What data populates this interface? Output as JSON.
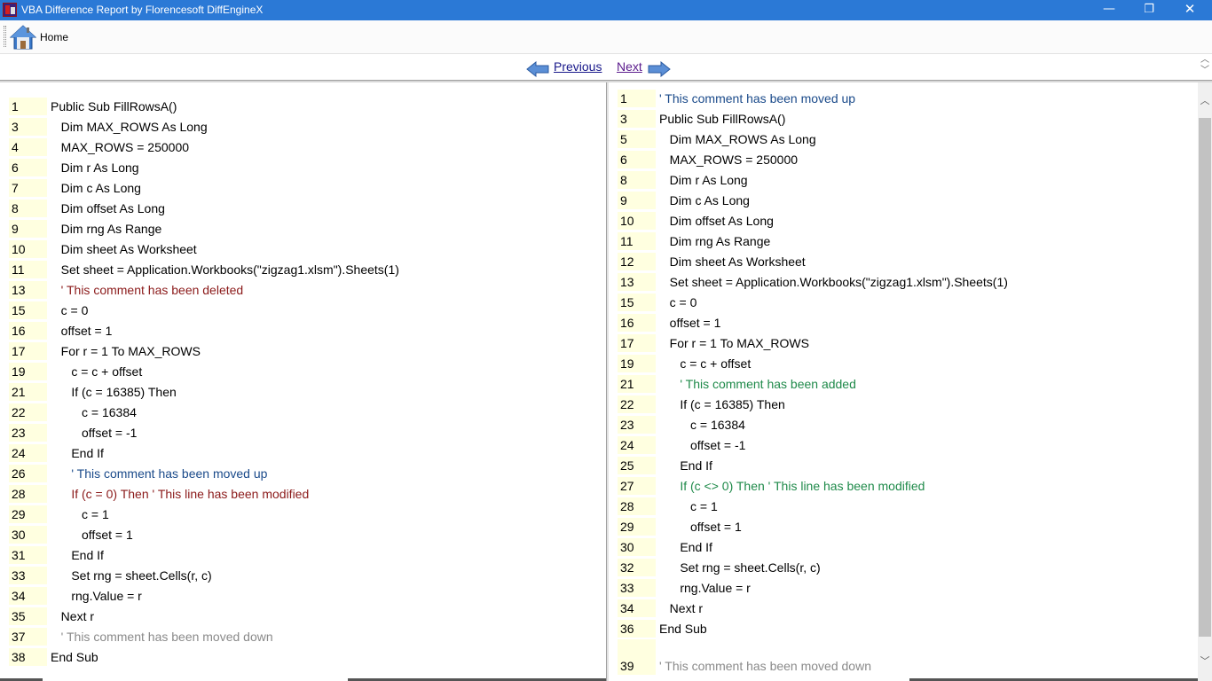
{
  "window": {
    "title": "VBA Difference Report by Florencesoft DiffEngineX",
    "minimize": "—",
    "maximize": "❐",
    "close": "✕"
  },
  "ribbon": {
    "home_label": "Home"
  },
  "nav": {
    "previous_label": "Previous",
    "next_label": "Next"
  },
  "colors": {
    "titlebar": "#2b79d6",
    "line_number_bg": "#ffffe0",
    "deleted": "#8b1a1a",
    "moved": "#1a4a8a",
    "added": "#1f8a4a",
    "moved_down": "#8a8a8a",
    "link": "#17178a"
  },
  "left_pane": {
    "lines": [
      {
        "num": "1",
        "text": "Public Sub FillRowsA()",
        "kind": "normal"
      },
      {
        "num": "3",
        "text": "   Dim MAX_ROWS As Long",
        "kind": "normal"
      },
      {
        "num": "4",
        "text": "   MAX_ROWS = 250000",
        "kind": "normal"
      },
      {
        "num": "6",
        "text": "   Dim r As Long",
        "kind": "normal"
      },
      {
        "num": "7",
        "text": "   Dim c As Long",
        "kind": "normal"
      },
      {
        "num": "8",
        "text": "   Dim offset As Long",
        "kind": "normal"
      },
      {
        "num": "9",
        "text": "   Dim rng As Range",
        "kind": "normal"
      },
      {
        "num": "10",
        "text": "   Dim sheet As Worksheet",
        "kind": "normal"
      },
      {
        "num": "11",
        "text": "   Set sheet = Application.Workbooks(\"zigzag1.xlsm\").Sheets(1)",
        "kind": "normal"
      },
      {
        "num": "13",
        "text": "   ' This comment has been deleted",
        "kind": "deleted"
      },
      {
        "num": "15",
        "text": "   c = 0",
        "kind": "normal"
      },
      {
        "num": "16",
        "text": "   offset = 1",
        "kind": "normal"
      },
      {
        "num": "17",
        "text": "   For r = 1 To MAX_ROWS",
        "kind": "normal"
      },
      {
        "num": "19",
        "text": "      c = c + offset",
        "kind": "normal"
      },
      {
        "num": "21",
        "text": "      If (c = 16385) Then",
        "kind": "normal"
      },
      {
        "num": "22",
        "text": "         c = 16384",
        "kind": "normal"
      },
      {
        "num": "23",
        "text": "         offset = -1",
        "kind": "normal"
      },
      {
        "num": "24",
        "text": "      End If",
        "kind": "normal"
      },
      {
        "num": "26",
        "text": "      ' This comment has been moved up",
        "kind": "moved"
      },
      {
        "num": "28",
        "text": "      If (c = 0) Then ' This line has been modified",
        "kind": "deleted"
      },
      {
        "num": "29",
        "text": "         c = 1",
        "kind": "normal"
      },
      {
        "num": "30",
        "text": "         offset = 1",
        "kind": "normal"
      },
      {
        "num": "31",
        "text": "      End If",
        "kind": "normal"
      },
      {
        "num": "33",
        "text": "      Set rng = sheet.Cells(r, c)",
        "kind": "normal"
      },
      {
        "num": "34",
        "text": "      rng.Value = r",
        "kind": "normal"
      },
      {
        "num": "35",
        "text": "   Next r",
        "kind": "normal"
      },
      {
        "num": "37",
        "text": "   ' This comment has been moved down",
        "kind": "moved-down"
      },
      {
        "num": "38",
        "text": "End Sub",
        "kind": "normal"
      }
    ]
  },
  "right_pane": {
    "lines": [
      {
        "num": "1",
        "text": "' This comment has been moved up",
        "kind": "moved"
      },
      {
        "num": "3",
        "text": "Public Sub FillRowsA()",
        "kind": "normal"
      },
      {
        "num": "5",
        "text": "   Dim MAX_ROWS As Long",
        "kind": "normal"
      },
      {
        "num": "6",
        "text": "   MAX_ROWS = 250000",
        "kind": "normal"
      },
      {
        "num": "8",
        "text": "   Dim r As Long",
        "kind": "normal"
      },
      {
        "num": "9",
        "text": "   Dim c As Long",
        "kind": "normal"
      },
      {
        "num": "10",
        "text": "   Dim offset As Long",
        "kind": "normal"
      },
      {
        "num": "11",
        "text": "   Dim rng As Range",
        "kind": "normal"
      },
      {
        "num": "12",
        "text": "   Dim sheet As Worksheet",
        "kind": "normal"
      },
      {
        "num": "13",
        "text": "   Set sheet = Application.Workbooks(\"zigzag1.xlsm\").Sheets(1)",
        "kind": "normal"
      },
      {
        "num": "15",
        "text": "   c = 0",
        "kind": "normal"
      },
      {
        "num": "16",
        "text": "   offset = 1",
        "kind": "normal"
      },
      {
        "num": "17",
        "text": "   For r = 1 To MAX_ROWS",
        "kind": "normal"
      },
      {
        "num": "19",
        "text": "      c = c + offset",
        "kind": "normal"
      },
      {
        "num": "21",
        "text": "      ' This comment has been added",
        "kind": "added"
      },
      {
        "num": "22",
        "text": "      If (c = 16385) Then",
        "kind": "normal"
      },
      {
        "num": "23",
        "text": "         c = 16384",
        "kind": "normal"
      },
      {
        "num": "24",
        "text": "         offset = -1",
        "kind": "normal"
      },
      {
        "num": "25",
        "text": "      End If",
        "kind": "normal"
      },
      {
        "num": "27",
        "text": "      If (c <> 0) Then ' This line has been modified",
        "kind": "added"
      },
      {
        "num": "28",
        "text": "         c = 1",
        "kind": "normal"
      },
      {
        "num": "29",
        "text": "         offset = 1",
        "kind": "normal"
      },
      {
        "num": "30",
        "text": "      End If",
        "kind": "normal"
      },
      {
        "num": "32",
        "text": "      Set rng = sheet.Cells(r, c)",
        "kind": "normal"
      },
      {
        "num": "33",
        "text": "      rng.Value = r",
        "kind": "normal"
      },
      {
        "num": "34",
        "text": "   Next r",
        "kind": "normal"
      },
      {
        "num": "36",
        "text": "End Sub",
        "kind": "normal"
      },
      {
        "num": "",
        "text": "",
        "kind": "normal"
      },
      {
        "num": "39",
        "text": "' This comment has been moved down",
        "kind": "moved-down"
      }
    ]
  }
}
